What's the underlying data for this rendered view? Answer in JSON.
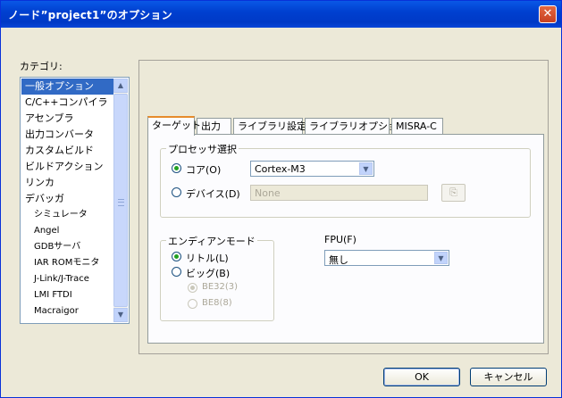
{
  "dialog": {
    "title": "ノード”project1”のオプション",
    "close_icon": "close-icon"
  },
  "category": {
    "label": "カテゴリ:",
    "items": [
      {
        "label": "一般オプション",
        "selected": true
      },
      {
        "label": "C/C++コンパイラ"
      },
      {
        "label": "アセンブラ"
      },
      {
        "label": "出力コンバータ"
      },
      {
        "label": "カスタムビルド"
      },
      {
        "label": "ビルドアクション"
      },
      {
        "label": "リンカ"
      },
      {
        "label": "デバッガ"
      },
      {
        "label": "シミュレータ",
        "sub": true
      },
      {
        "label": "Angel",
        "sub": true
      },
      {
        "label": "GDBサーバ",
        "sub": true
      },
      {
        "label": "IAR ROMモニタ",
        "sub": true
      },
      {
        "label": "J-Link/J-Trace",
        "sub": true
      },
      {
        "label": "LMI FTDI",
        "sub": true
      },
      {
        "label": "Macraigor",
        "sub": true
      }
    ]
  },
  "tabs": [
    "ターゲット",
    "出力",
    "ライブラリ設定",
    "ライブラリオプション",
    "MISRA-C"
  ],
  "processor": {
    "group_label": "プロセッサ選択",
    "core_label": "コア(O)",
    "core_value": "Cortex-M3",
    "device_label": "デバイス(D)",
    "device_value": "None"
  },
  "endian": {
    "group_label": "エンディアンモード",
    "little_label": "リトル(L)",
    "big_label": "ビッグ(B)",
    "be32_label": "BE32(3)",
    "be8_label": "BE8(8)"
  },
  "fpu": {
    "label": "FPU(F)",
    "value": "無し"
  },
  "buttons": {
    "ok": "OK",
    "cancel": "キャンセル"
  }
}
